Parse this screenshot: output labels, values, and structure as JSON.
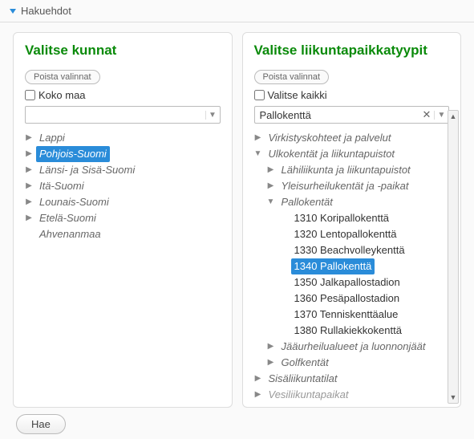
{
  "header": {
    "title": "Hakuehdot"
  },
  "panel_left": {
    "title": "Valitse kunnat",
    "clear_btn": "Poista valinnat",
    "chk_label": "Koko maa",
    "combo_value": "",
    "tree": [
      {
        "label": "Lappi",
        "expandable": true
      },
      {
        "label": "Pohjois-Suomi",
        "expandable": true,
        "selected": true
      },
      {
        "label": "Länsi- ja Sisä-Suomi",
        "expandable": true
      },
      {
        "label": "Itä-Suomi",
        "expandable": true
      },
      {
        "label": "Lounais-Suomi",
        "expandable": true
      },
      {
        "label": "Etelä-Suomi",
        "expandable": true
      },
      {
        "label": "Ahvenanmaa",
        "expandable": false
      }
    ]
  },
  "panel_right": {
    "title": "Valitse liikuntapaikkatyypit",
    "clear_btn": "Poista valinnat",
    "chk_label": "Valitse kaikki",
    "combo_value": "Pallokenttä",
    "tree": {
      "n0": {
        "label": "Virkistyskohteet ja palvelut",
        "tw": "▶"
      },
      "n1": {
        "label": "Ulkokentät ja liikuntapuistot",
        "tw": "▼"
      },
      "n1_0": {
        "label": "Lähiliikunta ja liikuntapuistot",
        "tw": "▶"
      },
      "n1_1": {
        "label": "Yleisurheilukentät ja -paikat",
        "tw": "▶"
      },
      "n1_2": {
        "label": "Pallokentät",
        "tw": "▼"
      },
      "n1_2_0": {
        "label": "1310 Koripallokenttä"
      },
      "n1_2_1": {
        "label": "1320 Lentopallokenttä"
      },
      "n1_2_2": {
        "label": "1330 Beachvolleykenttä"
      },
      "n1_2_3": {
        "label": "1340 Pallokenttä",
        "selected": true
      },
      "n1_2_4": {
        "label": "1350 Jalkapallostadion"
      },
      "n1_2_5": {
        "label": "1360 Pesäpallostadion"
      },
      "n1_2_6": {
        "label": "1370 Tenniskenttäalue"
      },
      "n1_2_7": {
        "label": "1380 Rullakiekkokenttä"
      },
      "n1_3": {
        "label": "Jääurheilualueet ja luonnonjäät",
        "tw": "▶"
      },
      "n1_4": {
        "label": "Golfkentät",
        "tw": "▶"
      },
      "n2": {
        "label": "Sisäliikuntatilat",
        "tw": "▶"
      },
      "n3": {
        "label": "Vesiliikuntapaikat",
        "tw": "▶"
      }
    }
  },
  "footer": {
    "submit": "Hae"
  }
}
